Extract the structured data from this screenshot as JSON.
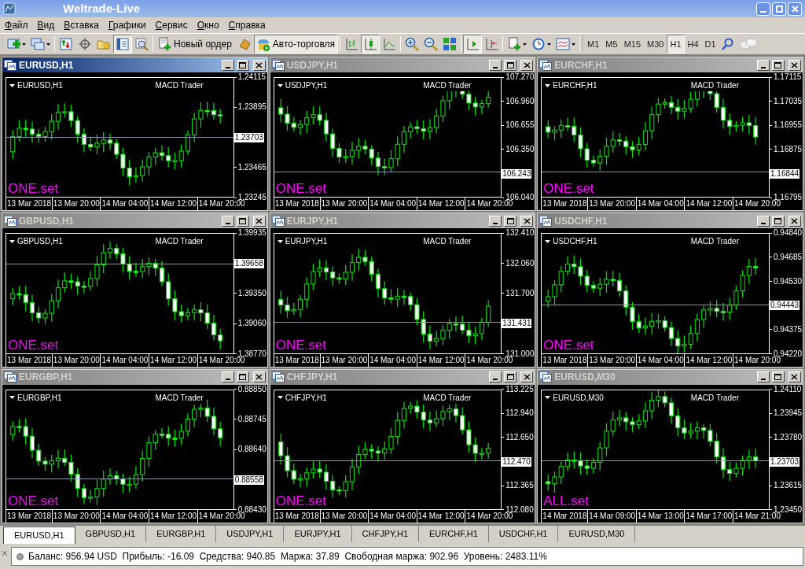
{
  "window": {
    "title": "Weltrade-Live"
  },
  "menu": [
    "Файл",
    "Вид",
    "Вставка",
    "Графики",
    "Сервис",
    "Окно",
    "Справка"
  ],
  "toolbar": {
    "buttons": [
      {
        "kind": "icon",
        "pressed": false
      },
      {
        "kind": "icon",
        "pressed": false
      },
      {
        "kind": "separator"
      },
      {
        "kind": "icon",
        "pressed": false
      },
      {
        "kind": "icon",
        "pressed": false
      },
      {
        "kind": "icon",
        "pressed": false
      },
      {
        "kind": "icon",
        "pressed": true
      },
      {
        "kind": "icon",
        "pressed": false
      },
      {
        "kind": "separator"
      },
      {
        "kind": "labeled",
        "label": "Новый ордер",
        "pressed": false
      },
      {
        "kind": "icon",
        "pressed": false
      },
      {
        "kind": "labeled",
        "label": "Авто-торговля",
        "pressed": true
      },
      {
        "kind": "separator"
      },
      {
        "kind": "icon",
        "pressed": false
      },
      {
        "kind": "icon",
        "pressed": true
      },
      {
        "kind": "icon",
        "pressed": false
      },
      {
        "kind": "separator"
      },
      {
        "kind": "icon",
        "pressed": false
      },
      {
        "kind": "icon",
        "pressed": false
      },
      {
        "kind": "icon",
        "pressed": false
      },
      {
        "kind": "separator"
      },
      {
        "kind": "icon",
        "pressed": true
      },
      {
        "kind": "icon",
        "pressed": false
      },
      {
        "kind": "separator"
      },
      {
        "kind": "icon",
        "pressed": false
      },
      {
        "kind": "icon",
        "pressed": false
      },
      {
        "kind": "icon",
        "pressed": false
      },
      {
        "kind": "separator"
      }
    ],
    "timeframes": [
      {
        "label": "M1",
        "selected": false
      },
      {
        "label": "M5",
        "selected": false
      },
      {
        "label": "M15",
        "selected": false
      },
      {
        "label": "M30",
        "selected": false
      },
      {
        "label": "H1",
        "selected": true
      },
      {
        "label": "H4",
        "selected": false
      },
      {
        "label": "D1",
        "selected": false
      }
    ]
  },
  "charts": [
    {
      "title": "EURUSD,H1",
      "active": true,
      "symbol": "EURUSD,H1",
      "expert": "MACD Trader",
      "set": "ONE.set",
      "yticks": [
        {
          "label": "1.24115",
          "kind": "tick"
        },
        {
          "label": "1.23895",
          "kind": "tick"
        },
        {
          "label": "1.23703",
          "kind": "price"
        },
        {
          "label": "1.23465",
          "kind": "tick"
        },
        {
          "label": "1.23245",
          "kind": "tick"
        }
      ],
      "xticks": [
        "13 Mar 2018",
        "13 Mar 20:00",
        "14 Mar 04:00",
        "14 Mar 12:00",
        "14 Mar 20:00"
      ]
    },
    {
      "title": "USDJPY,H1",
      "active": false,
      "symbol": "USDJPY,H1",
      "expert": "MACD Trader",
      "set": "ONE.set",
      "yticks": [
        {
          "label": "107.270",
          "kind": "tick"
        },
        {
          "label": "106.960",
          "kind": "tick"
        },
        {
          "label": "106.655",
          "kind": "tick"
        },
        {
          "label": "106.350",
          "kind": "tick"
        },
        {
          "label": "106.243",
          "kind": "price"
        },
        {
          "label": "106.040",
          "kind": "tick"
        }
      ],
      "xticks": [
        "13 Mar 2018",
        "13 Mar 20:00",
        "14 Mar 04:00",
        "14 Mar 12:00",
        "14 Mar 20:00"
      ]
    },
    {
      "title": "EURCHF,H1",
      "active": false,
      "symbol": "EURCHF,H1",
      "expert": "MACD Trader",
      "set": "ONE.set",
      "yticks": [
        {
          "label": "1.17115",
          "kind": "tick"
        },
        {
          "label": "1.17035",
          "kind": "tick"
        },
        {
          "label": "1.16955",
          "kind": "tick"
        },
        {
          "label": "1.16875",
          "kind": "tick"
        },
        {
          "label": "1.16844",
          "kind": "price"
        },
        {
          "label": "1.16795",
          "kind": "tick"
        }
      ],
      "xticks": [
        "13 Mar 2018",
        "13 Mar 20:00",
        "14 Mar 04:00",
        "14 Mar 12:00",
        "14 Mar 20:00"
      ]
    },
    {
      "title": "GBPUSD,H1",
      "active": false,
      "symbol": "GBPUSD,H1",
      "expert": "MACD Trader",
      "set": "ONE.set",
      "yticks": [
        {
          "label": "1.39935",
          "kind": "tick"
        },
        {
          "label": "1.39658",
          "kind": "price"
        },
        {
          "label": "1.39350",
          "kind": "tick"
        },
        {
          "label": "1.39060",
          "kind": "tick"
        },
        {
          "label": "1.38770",
          "kind": "tick"
        }
      ],
      "xticks": [
        "13 Mar 2018",
        "13 Mar 20:00",
        "14 Mar 04:00",
        "14 Mar 12:00",
        "14 Mar 20:00"
      ]
    },
    {
      "title": "EURJPY,H1",
      "active": false,
      "symbol": "EURJPY,H1",
      "expert": "MACD Trader",
      "set": "ONE.set",
      "yticks": [
        {
          "label": "132.410",
          "kind": "tick"
        },
        {
          "label": "132.060",
          "kind": "tick"
        },
        {
          "label": "131.700",
          "kind": "tick"
        },
        {
          "label": "131.431",
          "kind": "price"
        },
        {
          "label": "131.000",
          "kind": "tick"
        }
      ],
      "xticks": [
        "13 Mar 2018",
        "13 Mar 20:00",
        "14 Mar 04:00",
        "14 Mar 12:00",
        "14 Mar 20:00"
      ]
    },
    {
      "title": "USDCHF,H1",
      "active": false,
      "symbol": "USDCHF,H1",
      "expert": "MACD Trader",
      "set": "ONE.set",
      "yticks": [
        {
          "label": "0.94840",
          "kind": "tick"
        },
        {
          "label": "0.94685",
          "kind": "tick"
        },
        {
          "label": "0.94530",
          "kind": "tick"
        },
        {
          "label": "0.94443",
          "kind": "price"
        },
        {
          "label": "0.94375",
          "kind": "tick"
        },
        {
          "label": "0.94220",
          "kind": "tick"
        }
      ],
      "xticks": [
        "13 Mar 2018",
        "13 Mar 20:00",
        "14 Mar 04:00",
        "14 Mar 12:00",
        "14 Mar 20:00"
      ]
    },
    {
      "title": "EURGBP,H1",
      "active": false,
      "symbol": "EURGBP,H1",
      "expert": "MACD Trader",
      "set": "ONE.set",
      "yticks": [
        {
          "label": "0.88850",
          "kind": "tick"
        },
        {
          "label": "0.88745",
          "kind": "tick"
        },
        {
          "label": "0.88640",
          "kind": "tick"
        },
        {
          "label": "0.88558",
          "kind": "price"
        },
        {
          "label": "0.88430",
          "kind": "tick"
        }
      ],
      "xticks": [
        "13 Mar 2018",
        "13 Mar 20:00",
        "14 Mar 04:00",
        "14 Mar 12:00",
        "14 Mar 20:00"
      ]
    },
    {
      "title": "CHFJPY,H1",
      "active": false,
      "symbol": "CHFJPY,H1",
      "expert": "MACD Trader",
      "set": "ONE.set",
      "yticks": [
        {
          "label": "113.225",
          "kind": "tick"
        },
        {
          "label": "112.940",
          "kind": "tick"
        },
        {
          "label": "112.650",
          "kind": "tick"
        },
        {
          "label": "112.470",
          "kind": "price"
        },
        {
          "label": "112.365",
          "kind": "tick"
        },
        {
          "label": "112.080",
          "kind": "tick"
        }
      ],
      "xticks": [
        "13 Mar 2018",
        "13 Mar 20:00",
        "14 Mar 04:00",
        "14 Mar 12:00",
        "14 Mar 20:00"
      ]
    },
    {
      "title": "EURUSD,M30",
      "active": false,
      "symbol": "EURUSD,M30",
      "expert": "MACD Trader",
      "set": "ALL.set",
      "yticks": [
        {
          "label": "1.24110",
          "kind": "tick"
        },
        {
          "label": "1.23945",
          "kind": "tick"
        },
        {
          "label": "1.23780",
          "kind": "tick"
        },
        {
          "label": "1.23703",
          "kind": "price"
        },
        {
          "label": "1.23615",
          "kind": "tick"
        },
        {
          "label": "1.23450",
          "kind": "tick"
        }
      ],
      "xticks": [
        "14 Mar 2018",
        "14 Mar 09:00",
        "14 Mar 13:00",
        "14 Mar 17:00",
        "14 Mar 21:00"
      ]
    }
  ],
  "tabs": [
    {
      "label": "EURUSD,H1",
      "selected": true
    },
    {
      "label": "GBPUSD,H1",
      "selected": false
    },
    {
      "label": "EURGBP,H1",
      "selected": false
    },
    {
      "label": "USDJPY,H1",
      "selected": false
    },
    {
      "label": "EURJPY,H1",
      "selected": false
    },
    {
      "label": "CHFJPY,H1",
      "selected": false
    },
    {
      "label": "EURCHF,H1",
      "selected": false
    },
    {
      "label": "USDCHF,H1",
      "selected": false
    },
    {
      "label": "EURUSD,M30",
      "selected": false
    }
  ],
  "status_bar": {
    "text": "Баланс: 956.94 USD  Прибыль: -16.09  Средства: 940.85  Маржа: 37.89  Свободная маржа: 902.96  Уровень: 2483.11%"
  }
}
